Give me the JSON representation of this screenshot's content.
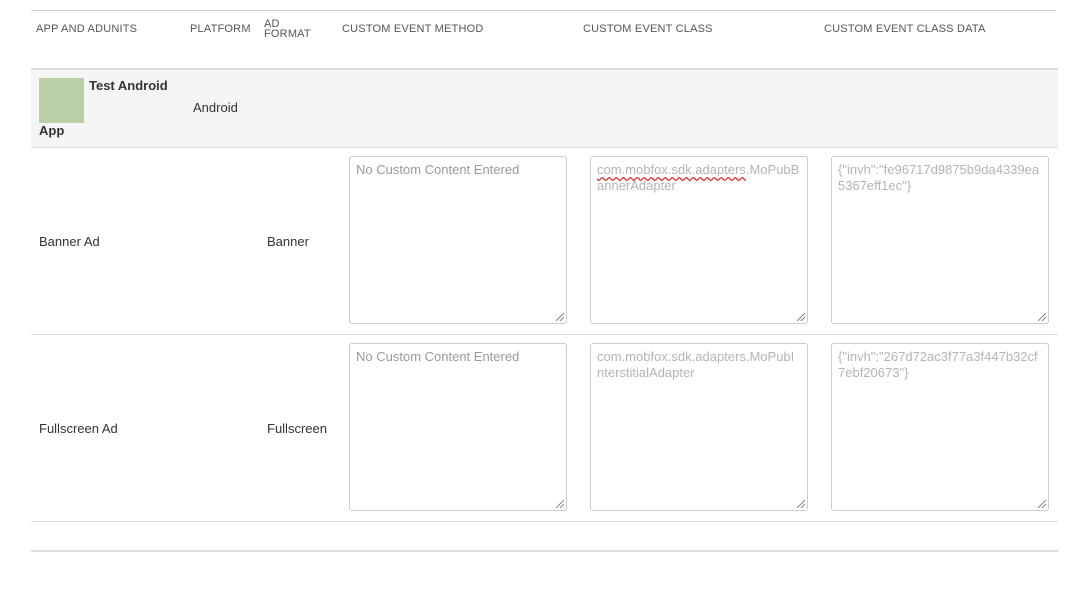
{
  "columns": {
    "app": "APP AND ADUNITS",
    "platform": "PLATFORM",
    "format_line1": "AD",
    "format_line2": "FORMAT",
    "method": "CUSTOM EVENT METHOD",
    "class": "CUSTOM EVENT CLASS",
    "class_data": "CUSTOM EVENT CLASS DATA"
  },
  "app": {
    "name_line1": "Test Android",
    "name_line2": "App",
    "platform": "Android"
  },
  "adunits": [
    {
      "name": "Banner Ad",
      "format": "Banner",
      "method_placeholder": "No Custom Content Entered",
      "class_prefix": "com.mobfox.sdk.adapters",
      "class_suffix": ".MoPubBannerAdapter",
      "class_data": "{\"invh\":\"fe96717d9875b9da4339ea5367eff1ec\"}"
    },
    {
      "name": "Fullscreen Ad",
      "format": "Fullscreen",
      "method_placeholder": "No Custom Content Entered",
      "class_prefix": "com.mobfox.sdk.adapters",
      "class_suffix": ".MoPubInterstitialAdapter",
      "class_data": "{\"invh\":\"267d72ac3f77a3f447b32cf7ebf20673\"}"
    }
  ]
}
